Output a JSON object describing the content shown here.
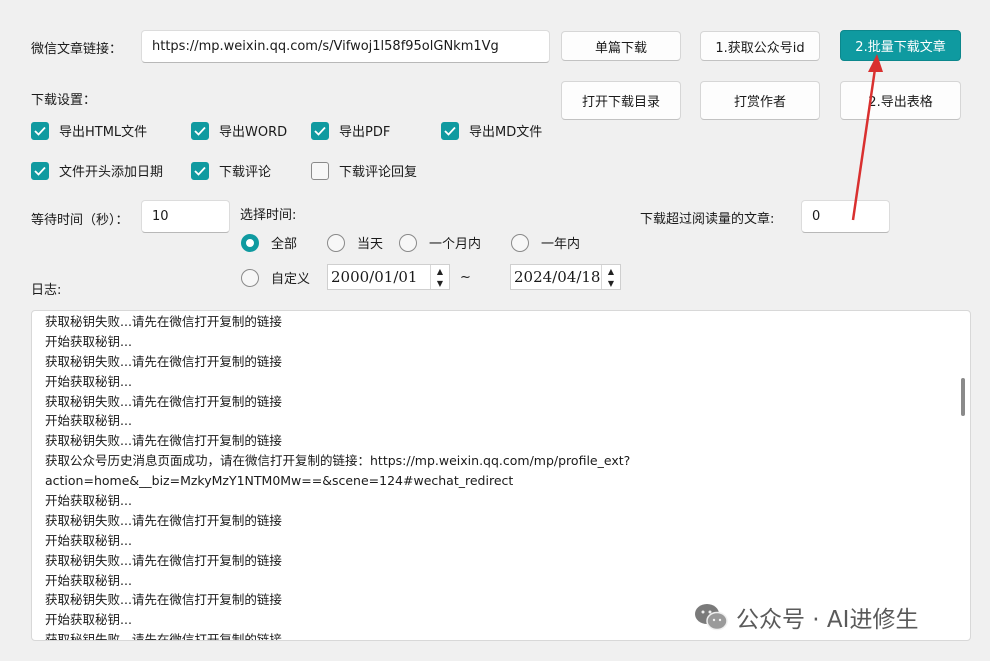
{
  "url_row": {
    "label": "微信文章链接：",
    "url_value": "https://mp.weixin.qq.com/s/Vifwoj1l58f95olGNkm1Vg"
  },
  "buttons": {
    "single_download": "单篇下载",
    "get_account_id": "1.获取公众号id",
    "batch_download": "2.批量下载文章",
    "open_dir": "打开下载目录",
    "tip_author": "打赏作者",
    "export_table": "2.导出表格"
  },
  "settings": {
    "title": "下载设置：",
    "checkboxes": [
      {
        "label": "导出HTML文件",
        "checked": true
      },
      {
        "label": "导出WORD",
        "checked": true
      },
      {
        "label": "导出PDF",
        "checked": true
      },
      {
        "label": "导出MD文件",
        "checked": true
      },
      {
        "label": "文件开头添加日期",
        "checked": true
      },
      {
        "label": "下载评论",
        "checked": true
      },
      {
        "label": "下载评论回复",
        "checked": false
      }
    ]
  },
  "wait": {
    "label": "等待时间（秒）：",
    "value": "10"
  },
  "time_select": {
    "label": "选择时间:",
    "options": [
      {
        "label": "全部",
        "selected": true
      },
      {
        "label": "当天",
        "selected": false
      },
      {
        "label": "一个月内",
        "selected": false
      },
      {
        "label": "一年内",
        "selected": false
      },
      {
        "label": "自定义",
        "selected": false
      }
    ],
    "start_date": "2000/01/01",
    "tilde": "~",
    "end_date": "2024/04/18"
  },
  "read_filter": {
    "label": "下载超过阅读量的文章:",
    "value": "0"
  },
  "log": {
    "label": "日志:",
    "lines": [
      "获取秘钥失败...请先在微信打开复制的链接",
      "开始获取秘钥...",
      "获取秘钥失败...请先在微信打开复制的链接",
      "开始获取秘钥...",
      "获取秘钥失败...请先在微信打开复制的链接",
      "开始获取秘钥...",
      "获取秘钥失败...请先在微信打开复制的链接",
      "获取公众号历史消息页面成功，请在微信打开复制的链接：https://mp.weixin.qq.com/mp/profile_ext?",
      "action=home&__biz=MzkyMzY1NTM0Mw==&scene=124#wechat_redirect",
      "开始获取秘钥...",
      "获取秘钥失败...请先在微信打开复制的链接",
      "开始获取秘钥...",
      "获取秘钥失败...请先在微信打开复制的链接",
      "开始获取秘钥...",
      "获取秘钥失败...请先在微信打开复制的链接",
      "开始获取秘钥...",
      "获取秘钥失败...请先在微信打开复制的链接"
    ]
  },
  "watermark": {
    "text": "公众号 · AI进修生",
    "icon": "wechat-icon"
  },
  "colors": {
    "accent": "#0f9aa0",
    "annotation_arrow": "#d9302f"
  }
}
